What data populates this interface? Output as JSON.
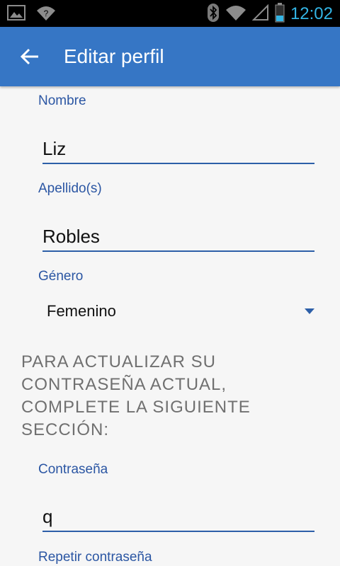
{
  "status_bar": {
    "time": "12:02",
    "icons": [
      "gallery-icon",
      "wifi-question-icon",
      "bluetooth-icon",
      "wifi-icon",
      "signal-icon",
      "battery-icon"
    ],
    "time_color": "#33b5e5"
  },
  "app_bar": {
    "title": "Editar perfil",
    "color": "#3676c5"
  },
  "form": {
    "name_label": "Nombre",
    "name_value": "Liz",
    "surname_label": "Apellido(s)",
    "surname_value": "Robles",
    "gender_label": "Género",
    "gender_value": "Femenino",
    "password_note": "PARA ACTUALIZAR SU CONTRASEÑA ACTUAL, COMPLETE LA SIGUIENTE SECCIÓN:",
    "password_label": "Contraseña",
    "password_value": "q",
    "repeat_password_label": "Repetir contraseña"
  }
}
